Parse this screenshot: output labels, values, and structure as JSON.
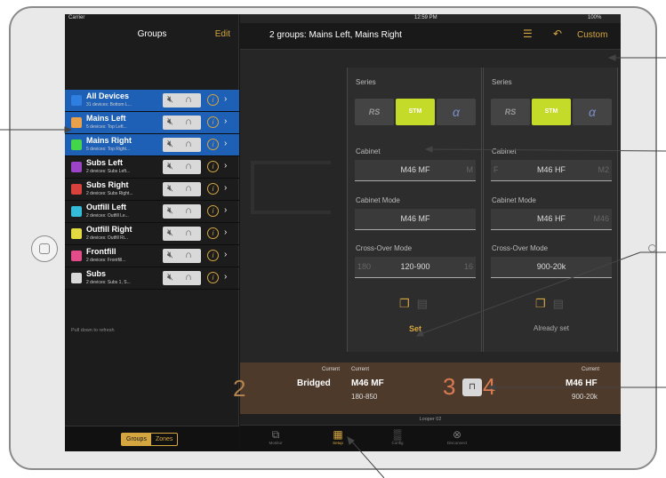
{
  "status": {
    "carrier": "Carrier",
    "time": "12:59 PM",
    "battery": "100%"
  },
  "sidebar": {
    "title": "Groups",
    "edit": "Edit",
    "groups": [
      {
        "name": "All Devices",
        "sub": "31 devices: Bottom L...",
        "color": "#2f7fe0",
        "selected": true
      },
      {
        "name": "Mains Left",
        "sub": "5 devices: Top Left...",
        "color": "#e8a04a",
        "selected": true
      },
      {
        "name": "Mains Right",
        "sub": "5 devices: Top Right...",
        "color": "#43d64a",
        "selected": true
      },
      {
        "name": "Subs Left",
        "sub": "2 devices: Subs Left...",
        "color": "#9b44c8",
        "selected": false
      },
      {
        "name": "Subs Right",
        "sub": "2 devices: Subs Right...",
        "color": "#d9413c",
        "selected": false
      },
      {
        "name": "Outfill Left",
        "sub": "2 devices: Outfill Le...",
        "color": "#35bcd8",
        "selected": false
      },
      {
        "name": "Outfill Right",
        "sub": "2 devices: Outfill Ri...",
        "color": "#e3d940",
        "selected": false
      },
      {
        "name": "Frontfill",
        "sub": "2 devices: Frontfill...",
        "color": "#e34c8a",
        "selected": false
      },
      {
        "name": "Subs",
        "sub": "2 devices: Subs 1, S...",
        "color": "#d8d8d8",
        "selected": false
      }
    ],
    "pull_refresh": "Pull down to refresh",
    "segment": {
      "groups": "Groups",
      "zones": "Zones"
    }
  },
  "nav": {
    "title": "2 groups: Mains Left, Mains Right",
    "custom": "Custom"
  },
  "panels": [
    {
      "series_label": "Series",
      "series": [
        "RS",
        "STM",
        "α"
      ],
      "cabinet_label": "Cabinet",
      "cabinet_value": "M46 MF",
      "cabinet_left": "",
      "cabinet_right": "M",
      "mode_label": "Cabinet Mode",
      "mode_value": "M46 MF",
      "mode_left": "",
      "mode_right": "",
      "xover_label": "Cross-Over Mode",
      "xover_value": "120-900",
      "xover_left": "180",
      "xover_right": "16",
      "action": "Set"
    },
    {
      "series_label": "Series",
      "series": [
        "RS",
        "STM",
        "α"
      ],
      "cabinet_label": "Cabinet",
      "cabinet_value": "M46 HF",
      "cabinet_left": "F",
      "cabinet_right": "M2",
      "mode_label": "Cabinet Mode",
      "mode_value": "M46 HF",
      "mode_left": "",
      "mode_right": "M46",
      "xover_label": "Cross-Over Mode",
      "xover_value": "900-20k",
      "xover_left": "",
      "xover_right": "",
      "action": "Already set"
    }
  ],
  "amp": {
    "ch2": "2",
    "ch2_current_label": "Current",
    "ch2_value": "Bridged",
    "ch3_current_label": "Current",
    "ch3_cabinet": "M46 MF",
    "ch3_range": "180-850",
    "ch3": "3",
    "ch4": "4",
    "ch4_current_label": "Current",
    "ch4_cabinet": "M46 HF",
    "ch4_range": "900-20k",
    "device": "Looper 02"
  },
  "tabs": [
    {
      "label": "Monitor",
      "icon": "⧉"
    },
    {
      "label": "Setup",
      "icon": "▦",
      "active": true
    },
    {
      "label": "Config",
      "icon": "▒"
    },
    {
      "label": "Disconnect",
      "icon": "⊗"
    }
  ]
}
